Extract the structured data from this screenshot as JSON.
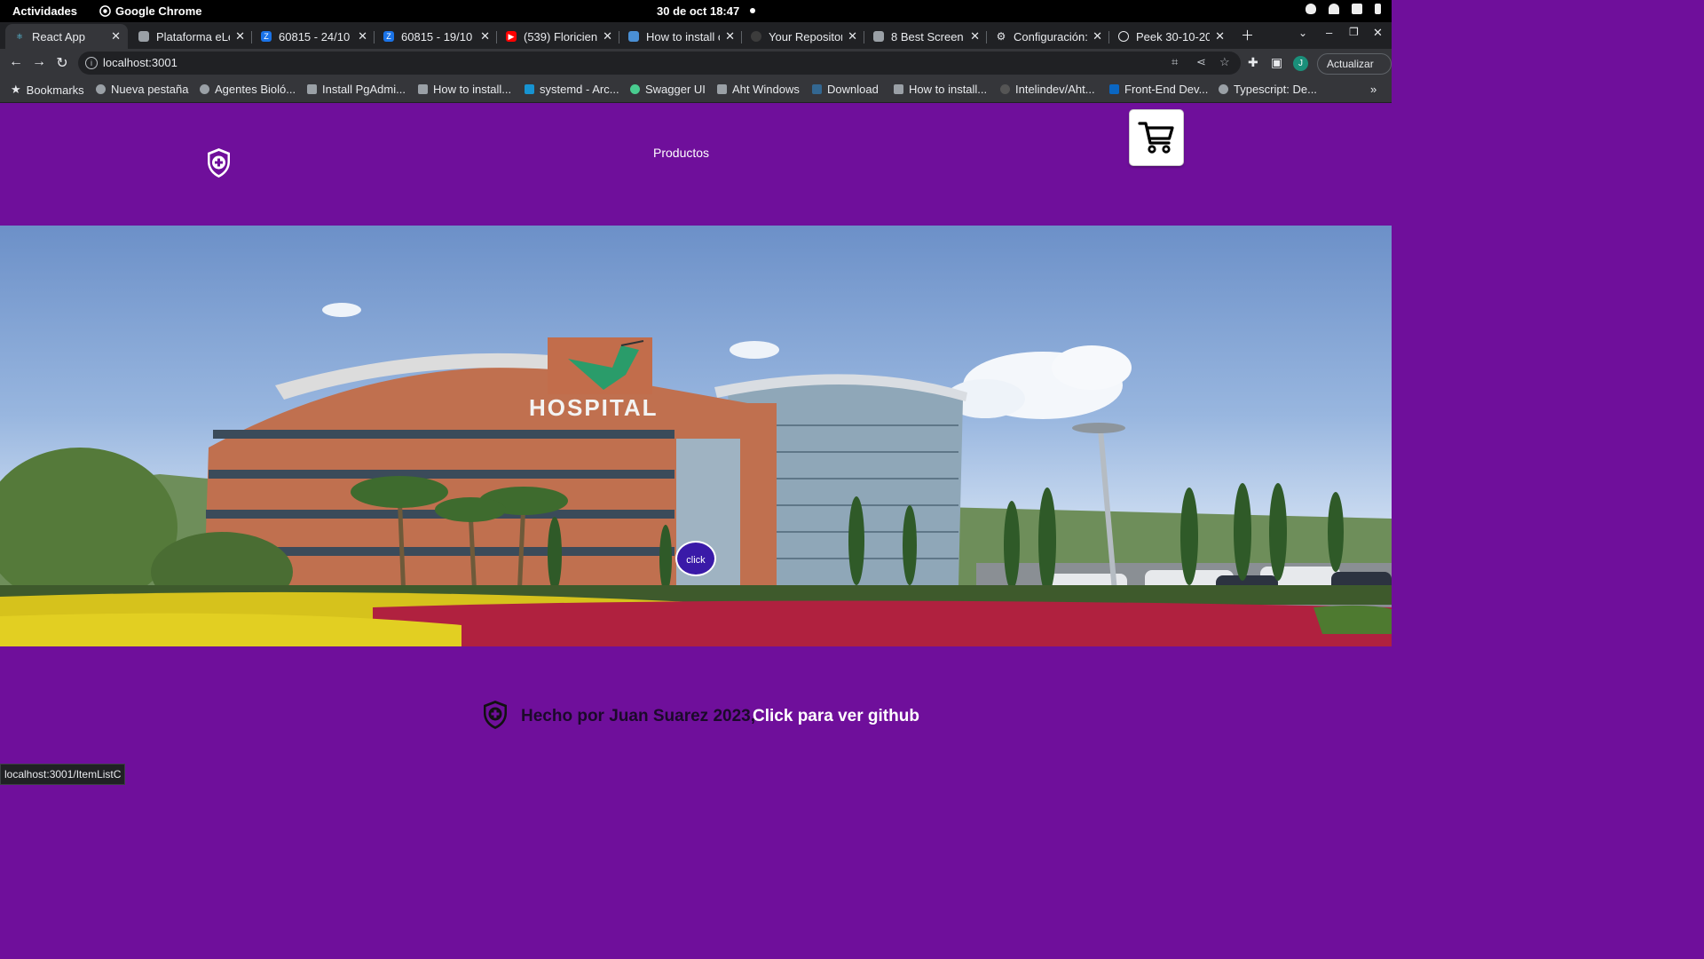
{
  "system_bar": {
    "activities": "Actividades",
    "app_name": "Google Chrome",
    "clock": "30 de oct  18:47"
  },
  "tabs": [
    {
      "label": "React App",
      "active": true
    },
    {
      "label": "Plataforma eLe"
    },
    {
      "label": "60815 - 24/10"
    },
    {
      "label": "60815 - 19/10"
    },
    {
      "label": "(539) Floricien"
    },
    {
      "label": "How to install c"
    },
    {
      "label": "Your Repositor"
    },
    {
      "label": "8 Best Screen F"
    },
    {
      "label": "Configuración:"
    },
    {
      "label": "Peek 30-10-20"
    }
  ],
  "toolbar": {
    "url": "localhost:3001",
    "update_label": "Actualizar",
    "avatar_letter": "J"
  },
  "bookmarks": [
    "Bookmarks",
    "Nueva pestaña",
    "Agentes Bioló...",
    "Install PgAdmi...",
    "How to install...",
    "systemd - Arc...",
    "Swagger UI",
    "Aht Windows",
    "Download",
    "How to install...",
    "Intelindev/Aht...",
    "Front-End Dev...",
    "Typescript: De..."
  ],
  "page": {
    "nav_products": "Productos",
    "hero_sign": "HOSPITAL",
    "click_label": "click",
    "footer_credit": "Hecho por Juan Suarez 2023,",
    "footer_link": "Click para ver github"
  },
  "status_url": "localhost:3001/ItemListC",
  "colors": {
    "page_bg": "#6f0f9b",
    "click_button": "#3a1aa8"
  }
}
